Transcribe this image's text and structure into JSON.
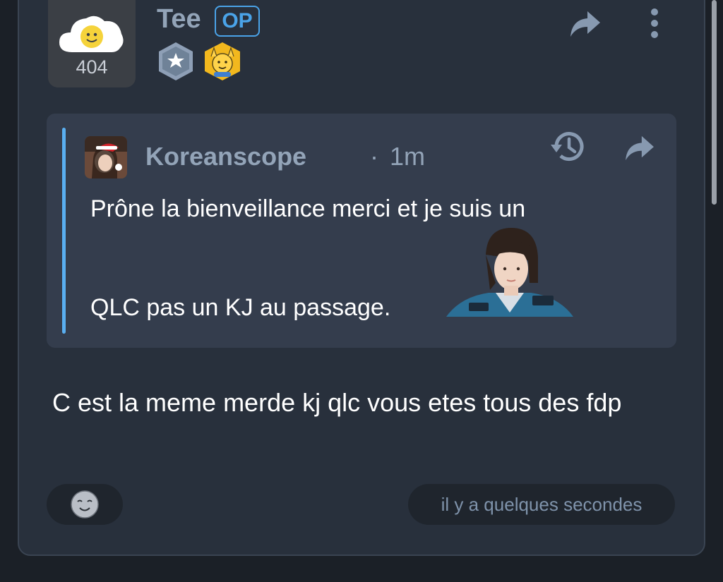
{
  "post": {
    "author": {
      "name": "Tee",
      "op_label": "OP",
      "avatar_count": "404",
      "avatar_icon": "smiling-cloud-icon",
      "badges": [
        "star-hexagon-badge",
        "hands-up-emoji-badge"
      ]
    },
    "actions": [
      "share-icon",
      "more-vertical-icon"
    ],
    "quote": {
      "author": "Koreanscope",
      "separator": "·",
      "time": "1m",
      "line1": "Prône la bienveillance merci et je suis un",
      "line2": "QLC pas un KJ au passage.",
      "actions": [
        "history-icon",
        "share-icon"
      ]
    },
    "message": "C est la meme merde kj qlc vous etes tous des fdp",
    "reaction_icon": "smiley-face-icon",
    "timestamp": "il y a quelques secondes"
  },
  "colors": {
    "card_background": "#28303c",
    "quote_background": "#343d4d",
    "quote_bar": "#5aaff0",
    "op_badge": "#4aa3e8",
    "muted_text": "#93a4b8"
  }
}
